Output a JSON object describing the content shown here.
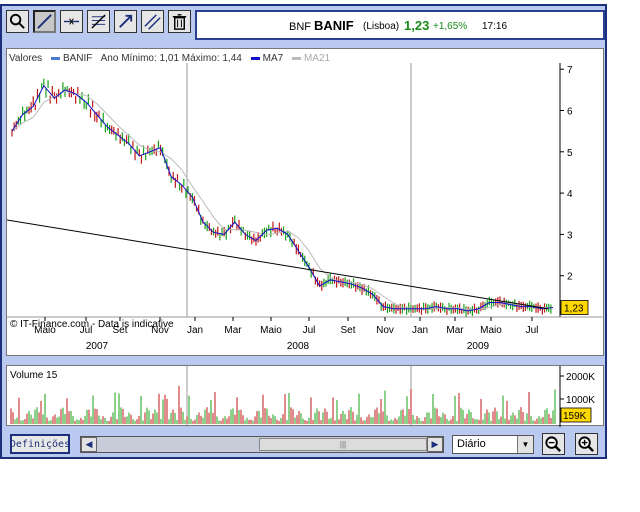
{
  "quote": {
    "code": "BNF",
    "name": "BANIF",
    "exchange": "(Lisboa)",
    "price": "1,23",
    "change": "+1,65%",
    "time": "17:16"
  },
  "toolbar": {
    "tools": [
      "zoom-tool",
      "draw-line-tool",
      "horizontal-line-tool",
      "fibonacci-tool",
      "trend-arrow-tool",
      "parallel-lines-tool",
      "delete-tool"
    ]
  },
  "legend": {
    "title": "Valores",
    "items": [
      {
        "label": "BANIF",
        "color": "#4a7bd0"
      },
      {
        "label": "Ano Mínimo: 1,01 Máximo: 1,44",
        "color": ""
      },
      {
        "label": "MA7",
        "color": "#1010c8"
      },
      {
        "label": "MA21",
        "color": "#bbbbbb"
      }
    ]
  },
  "credit": "© IT-Finance.com - Data is indicative",
  "volume": {
    "label": "Volume 15",
    "last": "159K",
    "ticks": [
      "2000K",
      "1000K"
    ]
  },
  "controls": {
    "settings_label": "Definições",
    "period_value": "Diário",
    "scroll_thumb_grip": "|||"
  },
  "colors": {
    "up": "#18a018",
    "down": "#c01818",
    "price_tag": "#ffd800",
    "frame": "#b9c9ef"
  },
  "chart_data": {
    "type": "line",
    "title": "",
    "y_ticks": [
      2,
      3,
      4,
      5,
      6,
      7
    ],
    "y_range": [
      1,
      7.15
    ],
    "current_price_label": "1,23",
    "x_months": [
      "Maio",
      "Jul",
      "Set",
      "Nov",
      "Jan",
      "Mar",
      "Maio",
      "Jul",
      "Set",
      "Nov",
      "Jan",
      "Mar",
      "Maio",
      "Jul"
    ],
    "x_years": [
      "2007",
      "2008",
      "2009"
    ],
    "trendline": {
      "start_value": 3.35,
      "end_value": 1.2
    },
    "series": [
      {
        "name": "BANIF",
        "approx_close_by_half_month": [
          5.5,
          5.9,
          6.1,
          6.6,
          6.3,
          6.5,
          6.4,
          6.2,
          5.9,
          5.6,
          5.4,
          5.2,
          4.9,
          5.0,
          5.1,
          4.4,
          4.2,
          3.9,
          3.3,
          3.05,
          3.0,
          3.3,
          3.0,
          2.85,
          3.1,
          3.15,
          3.0,
          2.6,
          2.2,
          1.75,
          1.9,
          1.85,
          1.8,
          1.7,
          1.55,
          1.25,
          1.2,
          1.2,
          1.2,
          1.2,
          1.25,
          1.2,
          1.2,
          1.15,
          1.2,
          1.35,
          1.35,
          1.3,
          1.25,
          1.25,
          1.2,
          1.23
        ]
      }
    ]
  }
}
